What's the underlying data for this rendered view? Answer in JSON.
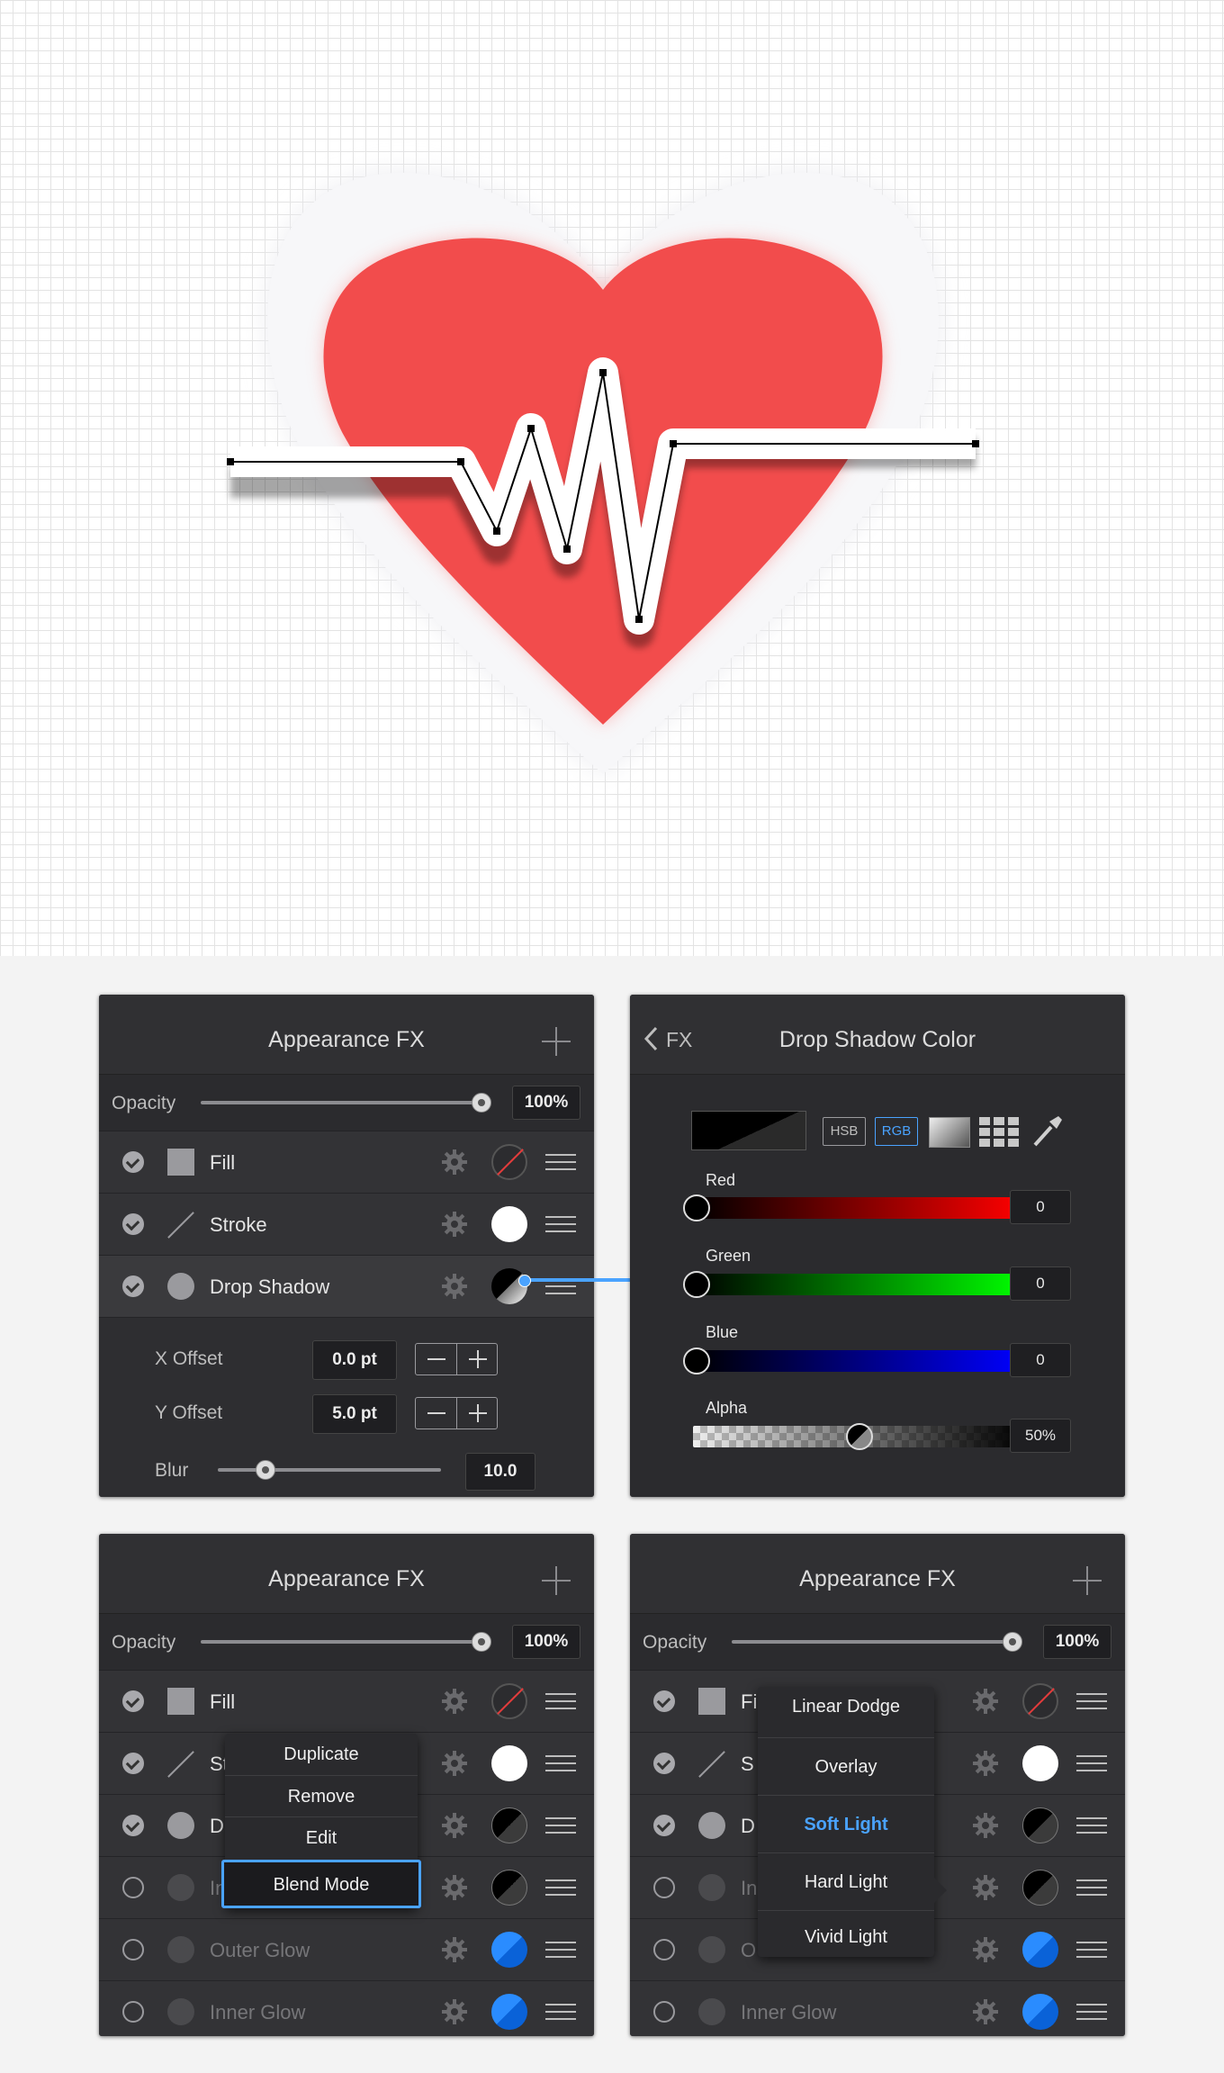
{
  "panels": {
    "appearance_top": {
      "title": "Appearance FX",
      "opacity_label": "Opacity",
      "opacity_value": "100%",
      "opacity_level": 1.0,
      "rows": [
        {
          "label": "Fill",
          "enabled": true,
          "icon": "fill-square-icon",
          "swatch": "none"
        },
        {
          "label": "Stroke",
          "enabled": true,
          "icon": "stroke-line-icon",
          "swatch": "white"
        },
        {
          "label": "Drop Shadow",
          "enabled": true,
          "icon": "shadow-circle-icon",
          "swatch": "black"
        }
      ],
      "x_offset_label": "X Offset",
      "x_offset_value": "0.0 pt",
      "y_offset_label": "Y Offset",
      "y_offset_value": "5.0 pt",
      "blur_label": "Blur",
      "blur_value": "10.0",
      "blur_level": 0.22
    },
    "shadow_color": {
      "back_label": "FX",
      "title": "Drop Shadow Color",
      "modes": [
        "HSB",
        "RGB"
      ],
      "active_mode": "RGB",
      "channels": [
        {
          "label": "Red",
          "value": "0",
          "color": "#ff0000"
        },
        {
          "label": "Green",
          "value": "0",
          "color": "#00ff00"
        },
        {
          "label": "Blue",
          "value": "0",
          "color": "#0000ff"
        }
      ],
      "alpha_label": "Alpha",
      "alpha_value": "50%",
      "alpha_level": 0.5
    },
    "appearance_bottom_left": {
      "title": "Appearance FX",
      "opacity_label": "Opacity",
      "opacity_value": "100%",
      "rows": [
        {
          "label": "Fill",
          "enabled": true
        },
        {
          "label": "St",
          "enabled": true
        },
        {
          "label": "Dr",
          "enabled": true
        },
        {
          "label": "In",
          "enabled": false
        },
        {
          "label": "Outer Glow",
          "enabled": false
        },
        {
          "label": "Inner Glow",
          "enabled": false
        }
      ],
      "context_menu": [
        "Duplicate",
        "Remove",
        "Edit",
        "Blend Mode"
      ],
      "context_menu_selected": "Blend Mode"
    },
    "appearance_bottom_right": {
      "title": "Appearance FX",
      "opacity_label": "Opacity",
      "opacity_value": "100%",
      "rows": [
        {
          "label": "Fi",
          "enabled": true
        },
        {
          "label": "S",
          "enabled": true
        },
        {
          "label": "D",
          "enabled": true
        },
        {
          "label": "In",
          "enabled": false
        },
        {
          "label": "O",
          "enabled": false
        },
        {
          "label": "Inner Glow",
          "enabled": false
        }
      ],
      "blend_modes": [
        "Linear Dodge",
        "Overlay",
        "Soft Light",
        "Hard Light",
        "Vivid Light"
      ],
      "blend_mode_selected": "Soft Light"
    }
  },
  "colors": {
    "heart": "#f24c4c",
    "panel_bg": "#303033",
    "accent_blue": "#4aa3ff"
  }
}
